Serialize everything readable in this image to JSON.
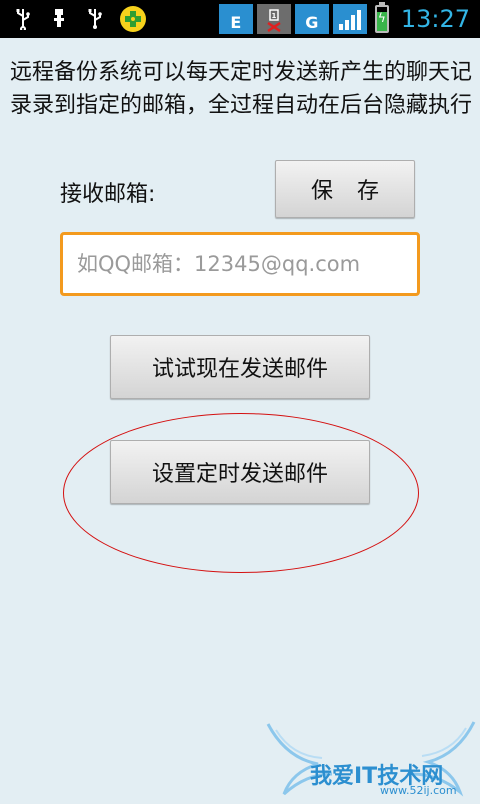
{
  "status_bar": {
    "network_type": "E",
    "signal_type": "G",
    "time": "13:27",
    "icons": [
      "usb-icon",
      "usb-icon",
      "usb-icon",
      "app-icon",
      "network-e-icon",
      "sim-icon",
      "signal-icon",
      "battery-icon"
    ]
  },
  "content": {
    "intro_text": "远程备份系统可以每天定时发送新产生的聊天记录录到指定的邮箱，全过程自动在后台隐藏执行",
    "email_label": "接收邮箱:",
    "save_button": "保存",
    "email_input": {
      "value": "",
      "placeholder": "如QQ邮箱：12345@qq.com"
    },
    "send_now_button": "试试现在发送邮件",
    "timed_send_button": "设置定时发送邮件"
  },
  "watermark": {
    "text": "我爱IT技术网",
    "url": "www.52ij.com"
  },
  "colors": {
    "background": "#e3eef3",
    "input_focus_border": "#f39a1e",
    "annotation_ellipse": "#d41010",
    "clock": "#33b5e5",
    "watermark": "#2c8fd0"
  }
}
